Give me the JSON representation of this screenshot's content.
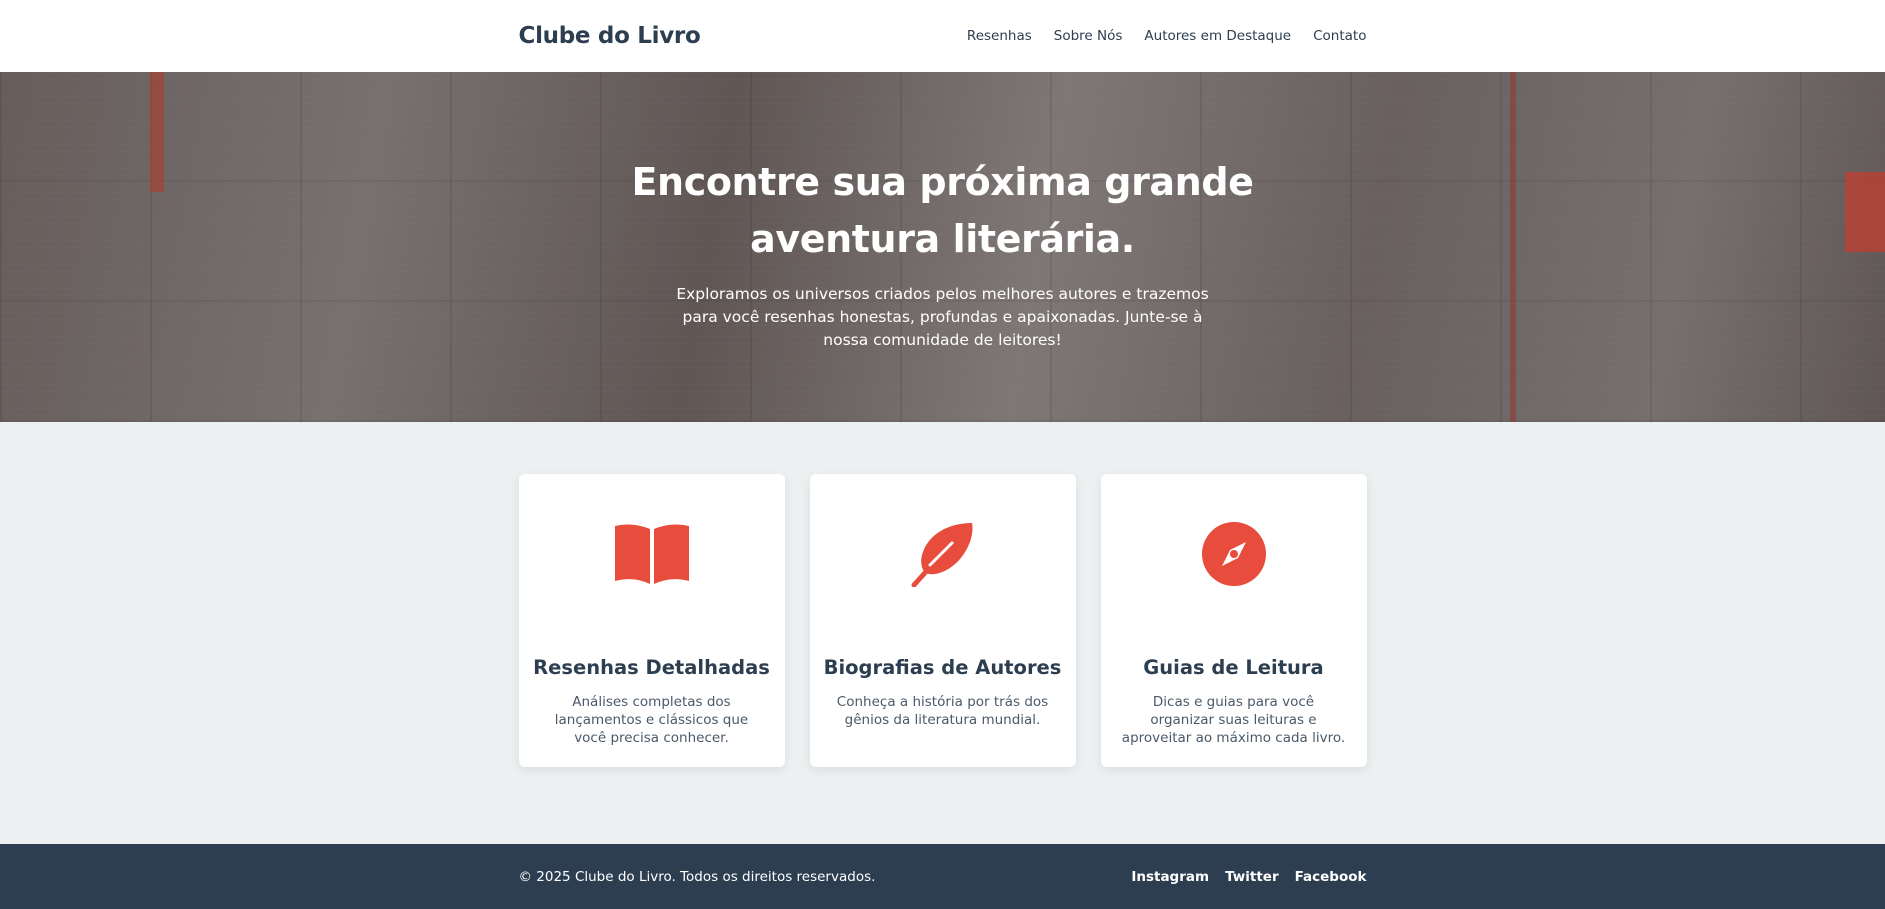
{
  "header": {
    "logo": "Clube do Livro",
    "nav": [
      {
        "label": "Resenhas"
      },
      {
        "label": "Sobre Nós"
      },
      {
        "label": "Autores em Destaque"
      },
      {
        "label": "Contato"
      }
    ]
  },
  "hero": {
    "title": "Encontre sua próxima grande aventura literária.",
    "subtitle": "Exploramos os universos criados pelos melhores autores e trazemos para você resenhas honestas, profundas e apaixonadas. Junte-se à nossa comunidade de leitores!"
  },
  "features": [
    {
      "icon": "book-open-icon",
      "title": "Resenhas Detalhadas",
      "text": "Análises completas dos lançamentos e clássicos que você precisa conhecer."
    },
    {
      "icon": "feather-icon",
      "title": "Biografias de Autores",
      "text": "Conheça a história por trás dos gênios da literatura mundial."
    },
    {
      "icon": "compass-icon",
      "title": "Guias de Leitura",
      "text": "Dicas e guias para você organizar suas leituras e aproveitar ao máximo cada livro."
    }
  ],
  "footer": {
    "copyright": "© 2025 Clube do Livro. Todos os direitos reservados.",
    "social": [
      {
        "label": "Instagram"
      },
      {
        "label": "Twitter"
      },
      {
        "label": "Facebook"
      }
    ]
  },
  "colors": {
    "accent": "#e74c3c",
    "dark": "#2c3e50",
    "background": "#ecf0f1"
  }
}
